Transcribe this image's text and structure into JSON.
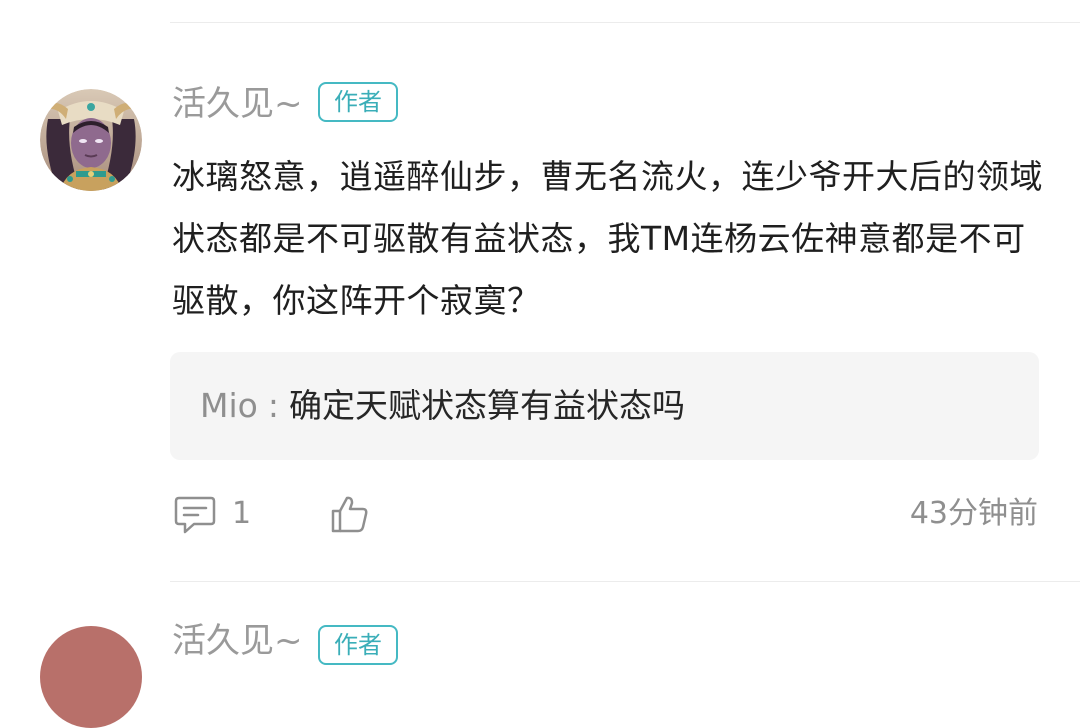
{
  "comment": {
    "username": "活久见~",
    "badge": "作者",
    "text": "冰璃怒意，逍遥醉仙步，曹无名流火，连少爷开大后的领域状态都是不可驱散有益状态，我TM连杨云佐神意都是不可驱散，你这阵开个寂寞？",
    "reply": {
      "author": "Mio",
      "separator": ":",
      "text": "确定天赋状态算有益状态吗"
    },
    "actions": {
      "comment_icon": "comment-bubble-icon",
      "comment_count": "1",
      "like_icon": "thumbs-up-icon",
      "time": "43分钟前"
    }
  },
  "next_comment": {
    "username": "活久见~",
    "badge": "作者"
  },
  "colors": {
    "accent": "#45b9c3",
    "muted_text": "#8f8f8f",
    "body_text": "#1f1f1f",
    "reply_bg": "#f5f5f5"
  }
}
